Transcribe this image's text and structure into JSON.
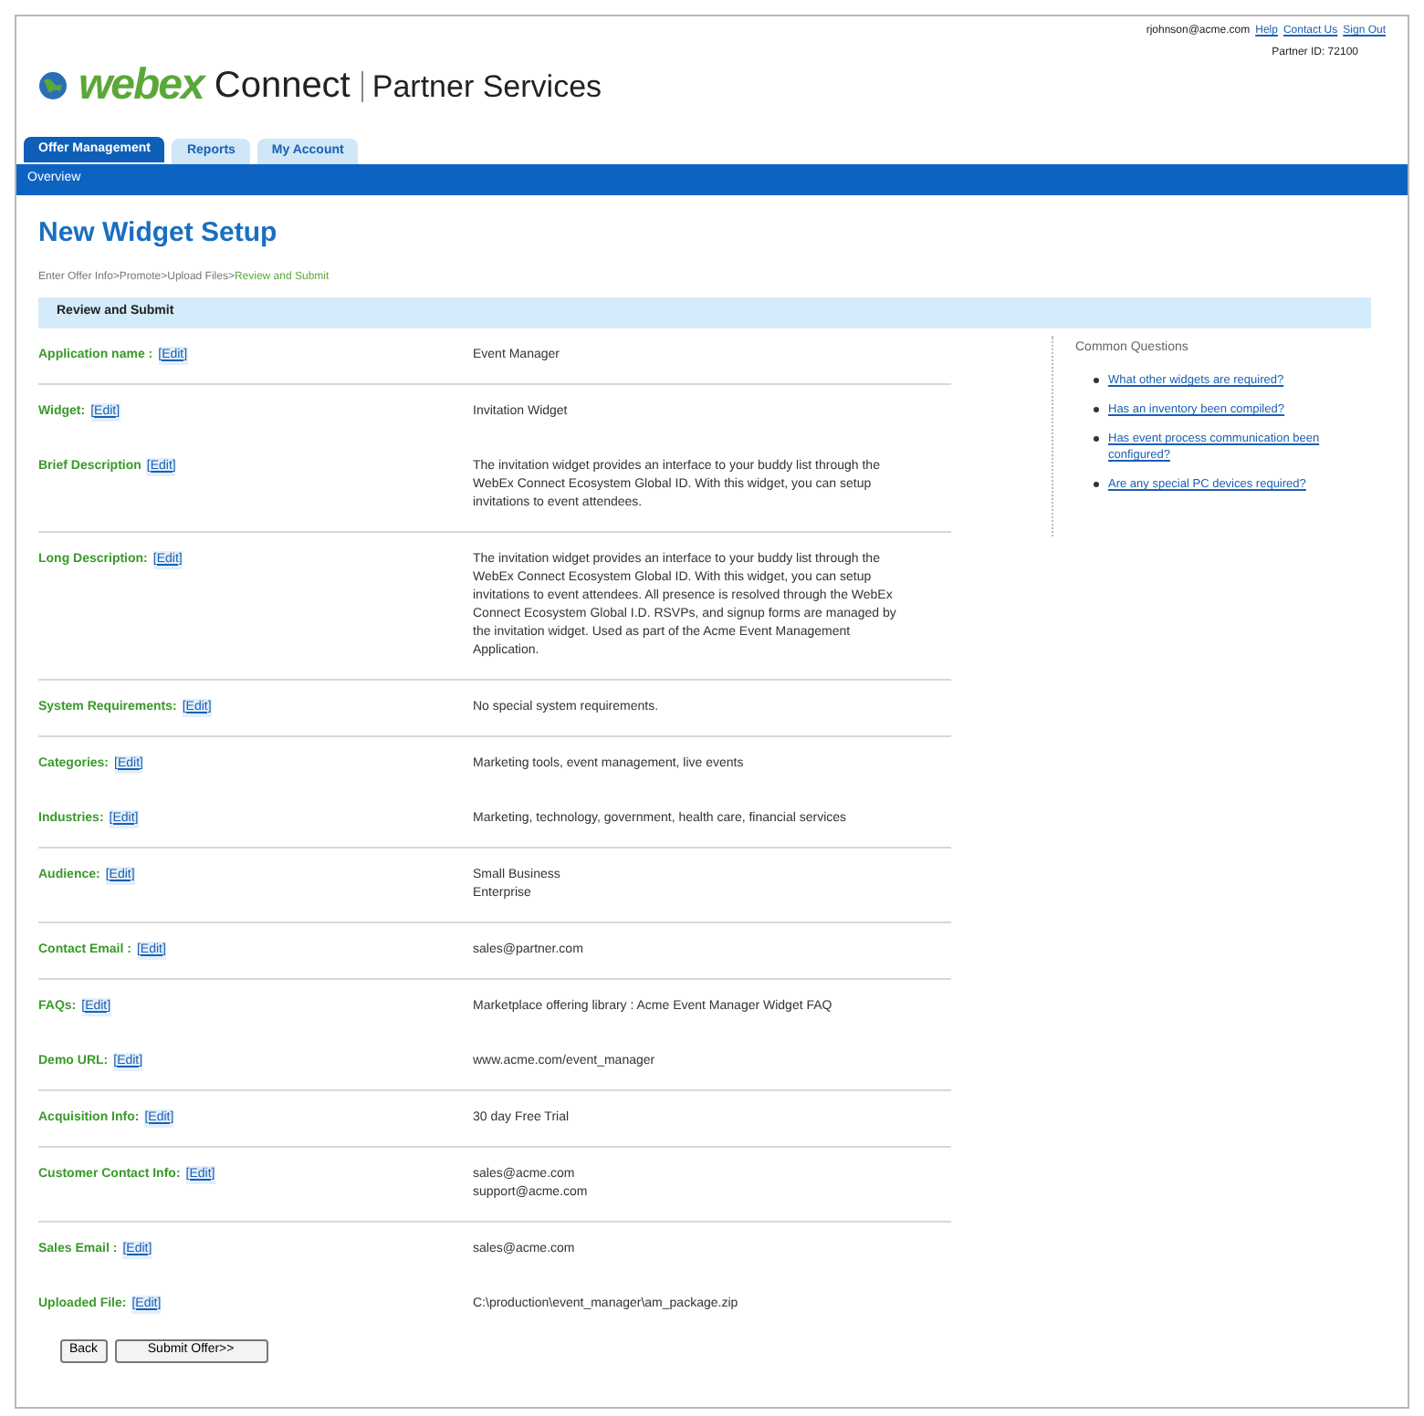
{
  "header": {
    "user": "rjohnson@acme.com",
    "links": [
      "Help",
      "Contact Us",
      "Sign Out"
    ],
    "partner_id": "Partner ID: 72100",
    "logo_text": "webex",
    "brand": "Connect",
    "subtitle": "Partner Services"
  },
  "tabs": [
    {
      "label": "Offer Management",
      "selected": true
    },
    {
      "label": "Reports",
      "selected": false
    },
    {
      "label": "My Account",
      "selected": false
    }
  ],
  "subnav": [
    "Overview"
  ],
  "page_title": "New Widget Setup",
  "breadcrumb": [
    {
      "label": "Enter Offer Info>",
      "selected": false
    },
    {
      "label": "Promote>",
      "selected": false
    },
    {
      "label": "Upload Files>",
      "selected": false
    },
    {
      "label": "Review and Submit",
      "selected": true
    }
  ],
  "section_title": "Review and Submit",
  "fields": [
    {
      "label": "Application name :",
      "edit": "[Edit]",
      "value": [
        "Event Manager"
      ],
      "divider": true
    },
    {
      "label": "Widget:",
      "edit": "[Edit]",
      "value": [
        "Invitation Widget"
      ],
      "divider": false
    },
    {
      "label": "Brief Description",
      "edit": "[Edit]",
      "value": [
        "The invitation widget provides an interface to your buddy list through the WebEx Connect Ecosystem Global ID.  With this widget, you can setup invitations to event attendees."
      ],
      "divider": true
    },
    {
      "label": "Long Description:",
      "edit": "[Edit]",
      "value": [
        "The invitation widget provides an interface to your buddy list through the WebEx Connect Ecosystem Global ID.  With this widget, you can setup invitations to event attendees. All presence is resolved through the WebEx Connect Ecosystem Global I.D.  RSVPs, and signup forms are managed by the invitation widget. Used as part of the Acme Event Management Application."
      ],
      "divider": true
    },
    {
      "label": "System Requirements:",
      "edit": "[Edit]",
      "value": [
        "No special system requirements."
      ],
      "divider": true
    },
    {
      "label": "Categories:",
      "edit": "[Edit]",
      "value": [
        "Marketing tools, event management, live events"
      ],
      "divider": false
    },
    {
      "label": "Industries:",
      "edit": "[Edit]",
      "value": [
        "Marketing, technology, government, health care, financial services"
      ],
      "divider": true
    },
    {
      "label": "Audience:",
      "edit": "[Edit]",
      "value": [
        "Small Business",
        "Enterprise"
      ],
      "divider": true
    },
    {
      "label": "Contact Email :",
      "edit": "[Edit]",
      "value": [
        "sales@partner.com"
      ],
      "divider": true
    },
    {
      "label": "FAQs:",
      "edit": "[Edit]",
      "value": [
        "Marketplace offering library : Acme Event Manager Widget FAQ"
      ],
      "divider": false
    },
    {
      "label": "Demo URL:",
      "edit": "[Edit]",
      "value": [
        "www.acme.com/event_manager"
      ],
      "divider": true
    },
    {
      "label": "Acquisition Info:",
      "edit": "[Edit]",
      "value": [
        "30 day Free Trial"
      ],
      "divider": true
    },
    {
      "label": "Customer Contact Info:",
      "edit": "[Edit]",
      "value": [
        "sales@acme.com",
        "support@acme.com"
      ],
      "divider": true
    },
    {
      "label": "Sales Email :",
      "edit": "[Edit]",
      "value": [
        "sales@acme.com"
      ],
      "divider": false
    },
    {
      "label": "Uploaded File:",
      "edit": "[Edit]",
      "value": [
        "C:\\production\\event_manager\\am_package.zip"
      ],
      "divider": false
    }
  ],
  "sidebar": {
    "title": "Common Questions",
    "links": [
      "What other widgets are required?",
      "Has an inventory been compiled?",
      "Has event process communication been configured?",
      "Are any special PC devices required?"
    ]
  },
  "buttons": [
    "Back",
    "Submit Offer>>"
  ]
}
